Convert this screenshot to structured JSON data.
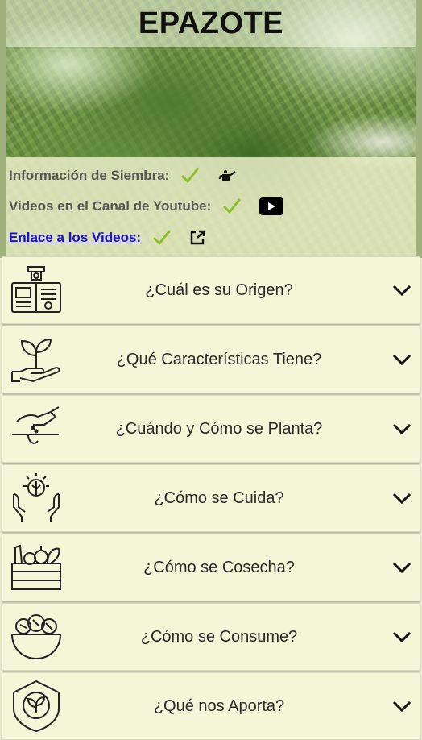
{
  "header": {
    "title": "EPAZOTE"
  },
  "info": {
    "planting_label": "Información de Siembra:",
    "videos_label": "Videos en el Canal de Youtube:",
    "link_label": "Enlace a los Videos:"
  },
  "colors": {
    "check": "#8bbf2a",
    "link": "#1a0dd6",
    "card_bg": "#f5f5d8"
  },
  "sections": [
    {
      "label": "¿Cuál es su Origen?",
      "icon": "origin-book-icon"
    },
    {
      "label": "¿Qué Características Tiene?",
      "icon": "sprout-hand-icon"
    },
    {
      "label": "¿Cuándo y Cómo se Planta?",
      "icon": "planting-hand-icon"
    },
    {
      "label": "¿Cómo se Cuida?",
      "icon": "care-hands-icon"
    },
    {
      "label": "¿Cómo se Cosecha?",
      "icon": "harvest-crate-icon"
    },
    {
      "label": "¿Cómo se Consume?",
      "icon": "food-bowl-icon"
    },
    {
      "label": "¿Qué nos Aporta?",
      "icon": "nutrition-shield-icon"
    }
  ]
}
